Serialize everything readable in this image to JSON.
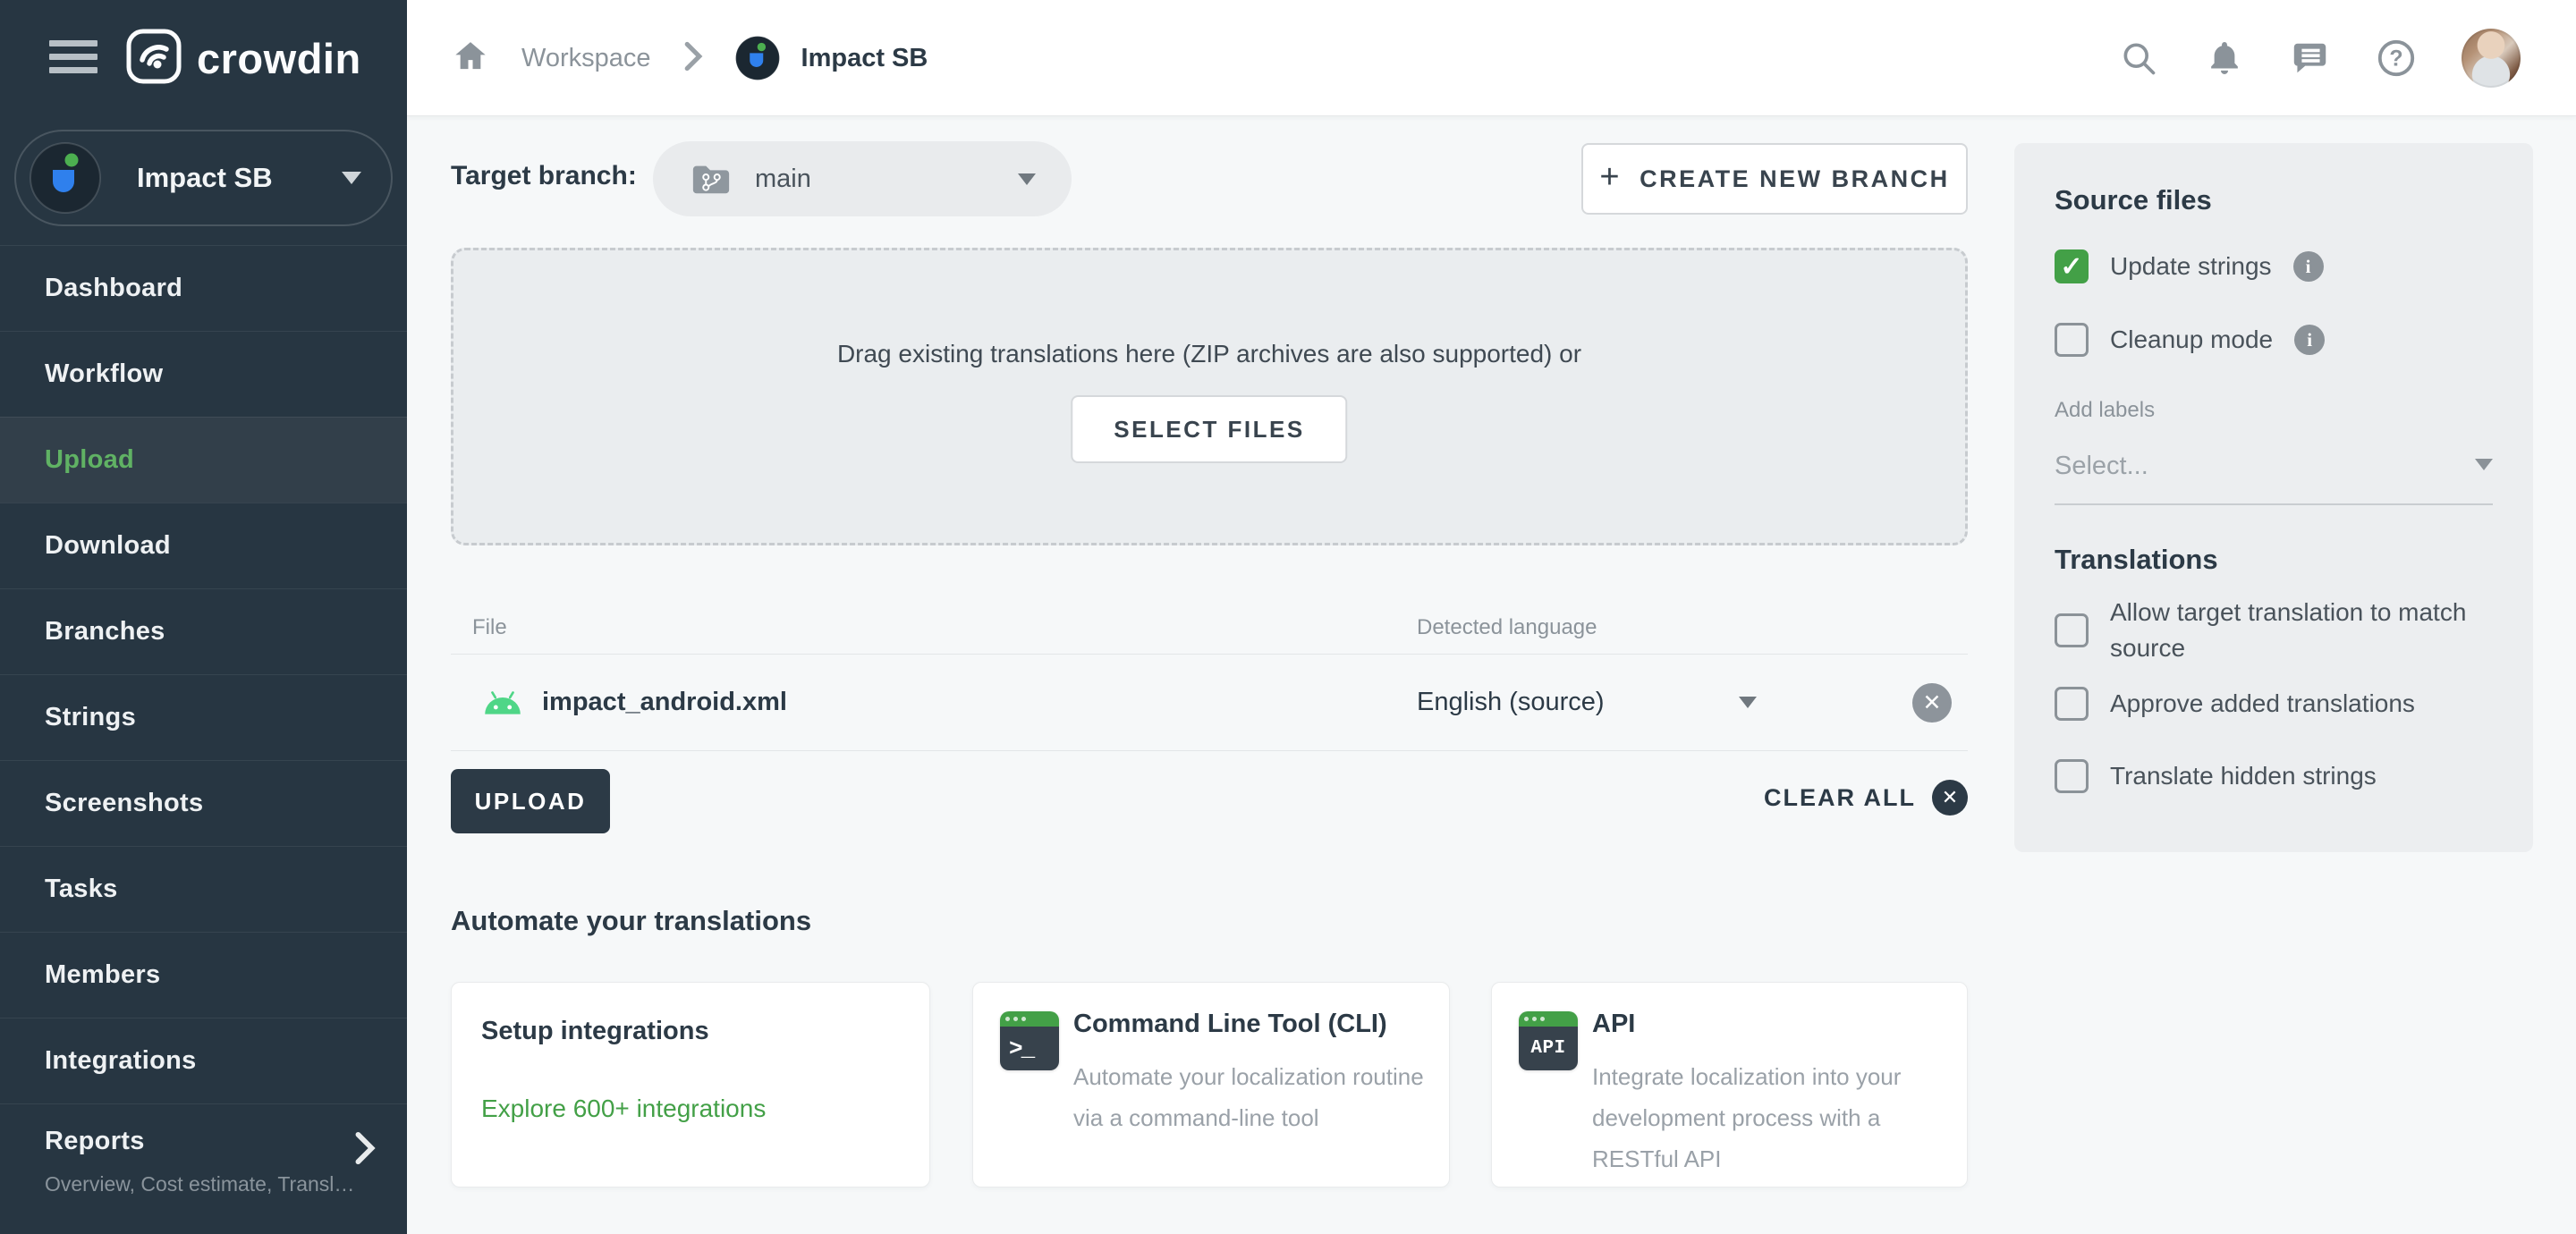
{
  "colors": {
    "accent_green": "#43a047",
    "sidebar_bg": "#273642",
    "sidebar_active_text": "#60b264",
    "android_green": "#4fd687",
    "project_blue": "#2f80ed",
    "dark_text": "#2c3a46",
    "muted_text": "#8b939a",
    "page_bg": "#f6f8f9",
    "panel_bg": "#eceef0"
  },
  "header": {
    "logo_text": "crowdin",
    "breadcrumb": {
      "workspace": "Workspace",
      "project": "Impact SB"
    },
    "icon_names": [
      "home-icon",
      "search-icon",
      "notifications-icon",
      "messages-icon",
      "help-icon",
      "user-avatar"
    ]
  },
  "sidebar": {
    "project_name": "Impact SB",
    "items": [
      {
        "label": "Dashboard",
        "active": false
      },
      {
        "label": "Workflow",
        "active": false
      },
      {
        "label": "Upload",
        "active": true
      },
      {
        "label": "Download",
        "active": false
      },
      {
        "label": "Branches",
        "active": false
      },
      {
        "label": "Strings",
        "active": false
      },
      {
        "label": "Screenshots",
        "active": false
      },
      {
        "label": "Tasks",
        "active": false
      },
      {
        "label": "Members",
        "active": false
      },
      {
        "label": "Integrations",
        "active": false
      }
    ],
    "reports": {
      "label": "Reports",
      "subtitle": "Overview, Cost estimate, Transl…"
    }
  },
  "main": {
    "target_branch_label": "Target branch:",
    "branch_selector": {
      "value": "main",
      "icon": "git-branch-folder-icon"
    },
    "create_branch_button": {
      "plus": "+",
      "label": "CREATE NEW BRANCH"
    },
    "dropzone": {
      "text": "Drag existing translations here (ZIP archives are also supported) or",
      "select_files_button": "SELECT FILES"
    },
    "files_table": {
      "columns": {
        "file": "File",
        "detected_language": "Detected language"
      },
      "rows": [
        {
          "file": "impact_android.xml",
          "file_icon": "android-icon",
          "detected_language": "English (source)"
        }
      ]
    },
    "upload_button": "UPLOAD",
    "clear_all_button": {
      "label": "CLEAR ALL",
      "icon": "clear-all-x-icon",
      "x": "✕"
    },
    "row_remove_x": "✕",
    "automate": {
      "heading": "Automate your translations",
      "cards": [
        {
          "title": "Setup integrations",
          "link": "Explore 600+ integrations"
        },
        {
          "title": "Command Line Tool (CLI)",
          "icon": "terminal-icon",
          "icon_glyph": ">_",
          "description": "Automate your localization routine via a command-line tool"
        },
        {
          "title": "API",
          "icon": "api-icon",
          "icon_glyph": "API",
          "description": "Integrate localization into your development process with a RESTful API"
        }
      ]
    }
  },
  "panel": {
    "source_files_heading": "Source files",
    "options": [
      {
        "label": "Update strings",
        "checked": true,
        "info": true
      },
      {
        "label": "Cleanup mode",
        "checked": false,
        "info": true
      }
    ],
    "add_labels_label": "Add labels",
    "labels_select_placeholder": "Select...",
    "translations_heading": "Translations",
    "translation_options": [
      {
        "label": "Allow target translation to match source",
        "checked": false
      },
      {
        "label": "Approve added translations",
        "checked": false
      },
      {
        "label": "Translate hidden strings",
        "checked": false
      }
    ]
  }
}
